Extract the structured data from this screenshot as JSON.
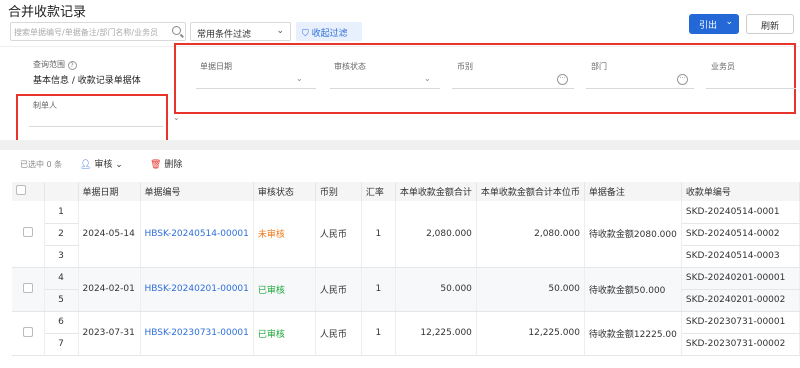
{
  "page_title": "合并收款记录",
  "search": {
    "placeholder": "搜索单据编号/单据备注/部门名称/业务员"
  },
  "preset_filter": {
    "value": "常用条件过滤"
  },
  "collapse_filter_label": "收起过滤",
  "actions": {
    "export_label": "引出",
    "refresh_label": "刷新"
  },
  "filters": {
    "scope": {
      "label": "查询范围",
      "value": "基本信息 / 收款记录单据体"
    },
    "doc_date": {
      "label": "单据日期"
    },
    "review_status": {
      "label": "审核状态"
    },
    "currency": {
      "label": "币别"
    },
    "department": {
      "label": "部门"
    },
    "salesman": {
      "label": "业务员"
    },
    "creator": {
      "label": "制单人"
    }
  },
  "toolbar": {
    "selected_text": "已选中 0 条",
    "review_label": "审核",
    "delete_label": "删除"
  },
  "table": {
    "columns": [
      "单据日期",
      "单据编号",
      "审核状态",
      "币别",
      "汇率",
      "本单收款金额合计",
      "本单收款金额合计本位币",
      "单据备注",
      "收款单编号"
    ],
    "groups": [
      {
        "date": "2024-05-14",
        "doc_no": "HBSK-20240514-00001",
        "status": "未审核",
        "currency": "人民币",
        "rate": "1",
        "total": "2,080.000",
        "total_base": "2,080.000",
        "remark": "待收款金额2080.000",
        "rows": [
          {
            "idx": "1",
            "receipt": "SKD-20240514-0001"
          },
          {
            "idx": "2",
            "receipt": "SKD-20240514-0002"
          },
          {
            "idx": "3",
            "receipt": "SKD-20240514-0003"
          }
        ]
      },
      {
        "date": "2024-02-01",
        "doc_no": "HBSK-20240201-00001",
        "status": "已审核",
        "currency": "人民币",
        "rate": "1",
        "total": "50.000",
        "total_base": "50.000",
        "remark": "待收款金额50.000",
        "rows": [
          {
            "idx": "4",
            "receipt": "SKD-20240201-00001"
          },
          {
            "idx": "5",
            "receipt": "SKD-20240201-00002"
          }
        ]
      },
      {
        "date": "2023-07-31",
        "doc_no": "HBSK-20230731-00001",
        "status": "已审核",
        "currency": "人民币",
        "rate": "1",
        "total": "12,225.000",
        "total_base": "12,225.000",
        "remark": "待收款金额12225.00",
        "rows": [
          {
            "idx": "6",
            "receipt": "SKD-20230731-00001"
          },
          {
            "idx": "7",
            "receipt": "SKD-20230731-00002"
          }
        ]
      }
    ]
  },
  "colors": {
    "accent": "#2468d8",
    "highlight": "#e8352b",
    "pending": "#f07a1a",
    "approved": "#1fa83b"
  }
}
